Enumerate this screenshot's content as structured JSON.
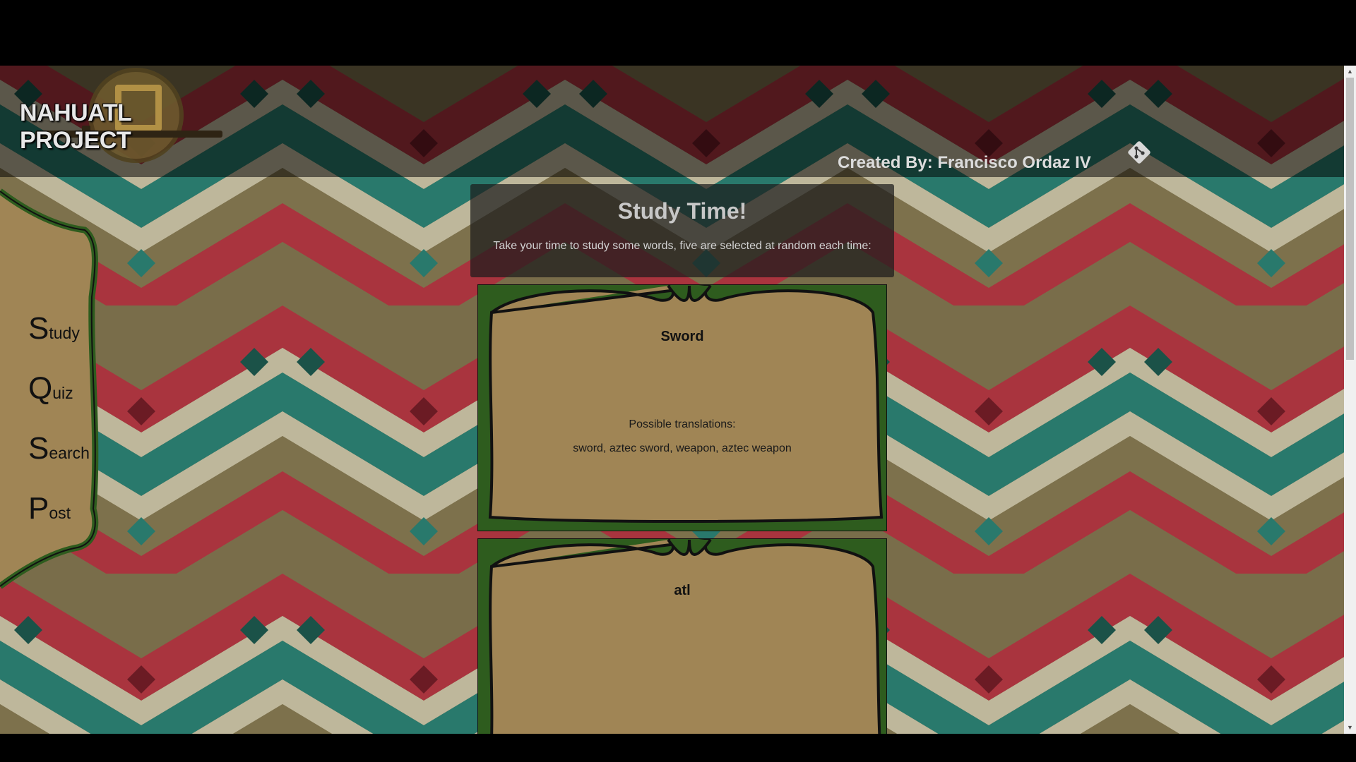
{
  "header": {
    "logo_text": "NAHUATL PROJECT",
    "creator": "Created By: Francisco Ordaz IV",
    "repo_icon": "git-icon"
  },
  "sidebar": {
    "items": [
      {
        "cap": "S",
        "rest": "tudy"
      },
      {
        "cap": "Q",
        "rest": "uiz"
      },
      {
        "cap": "S",
        "rest": "earch"
      },
      {
        "cap": "P",
        "rest": "ost"
      }
    ]
  },
  "study": {
    "title": "Study Time!",
    "subtitle": "Take your time to study some words, five are selected at random each time:"
  },
  "cards": [
    {
      "word": "Sword",
      "label": "Possible translations:",
      "translations": "sword, aztec sword, weapon, aztec weapon"
    },
    {
      "word": "atl"
    }
  ],
  "colors": {
    "card_green": "#2e5c1e",
    "card_parchment": "#a08555",
    "bg_red": "#b83a44",
    "bg_teal": "#2f8a7a",
    "bg_cream": "#d8d0b0",
    "bg_olive": "#8a7d55"
  }
}
